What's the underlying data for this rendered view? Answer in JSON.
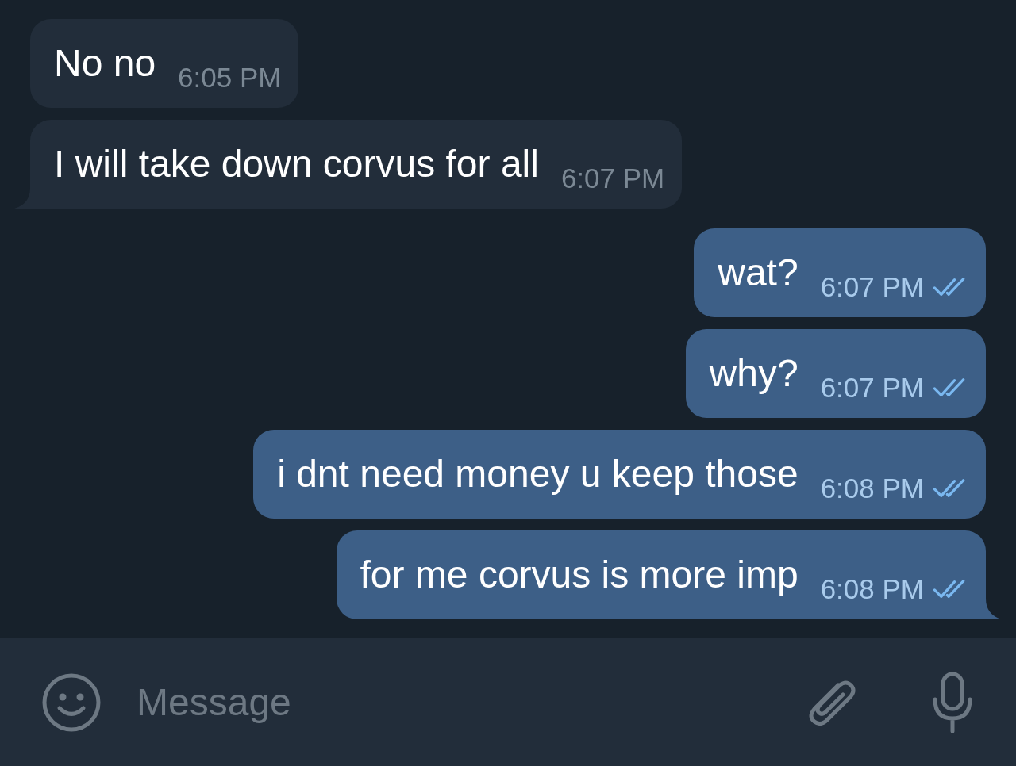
{
  "messages": [
    {
      "kind": "incoming",
      "text": "No no",
      "time": "6:05 PM",
      "tail": false
    },
    {
      "kind": "incoming",
      "text": "I will take down corvus for all",
      "time": "6:07 PM",
      "tail": true
    },
    {
      "kind": "outgoing",
      "text": "wat?",
      "time": "6:07 PM",
      "read": true,
      "tail": false
    },
    {
      "kind": "outgoing",
      "text": "why?",
      "time": "6:07 PM",
      "read": true,
      "tail": false
    },
    {
      "kind": "outgoing",
      "text": "i dnt need money u keep those",
      "time": "6:08 PM",
      "read": true,
      "tail": false
    },
    {
      "kind": "outgoing",
      "text": "for me corvus is more imp",
      "time": "6:08 PM",
      "read": true,
      "tail": true
    }
  ],
  "composer": {
    "placeholder": "Message"
  }
}
